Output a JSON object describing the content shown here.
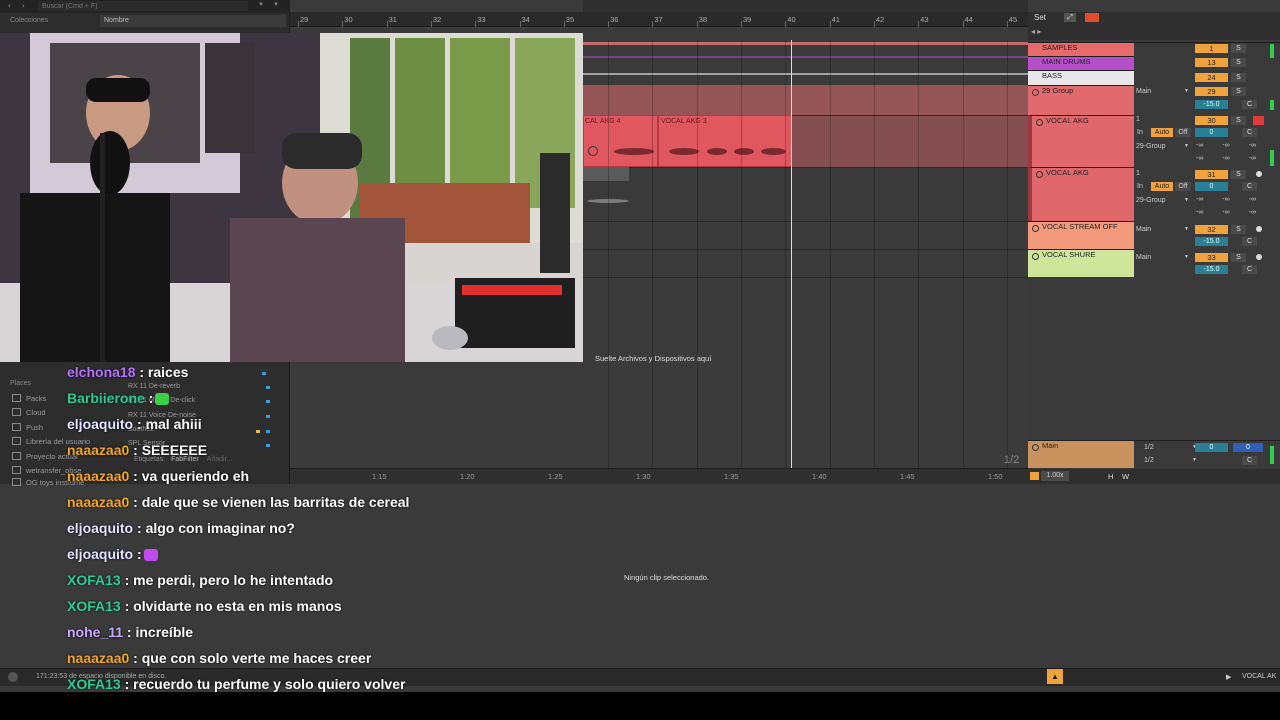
{
  "browser": {
    "search_placeholder": "Buscar (Cmd + F)",
    "collections_label": "Colecciones",
    "name_header": "Nombre",
    "places_label": "Places",
    "places": [
      "Packs",
      "Cloud",
      "Push",
      "Librería del usuario",
      "Proyecto actual",
      "wetransfer_obse",
      "OG toys instrume"
    ],
    "files": [
      "RX 11 De-reverb",
      "RX 11 Mouth De-click",
      "RX 11 Voice De-noise",
      "Soothe2",
      "SPL Sensor"
    ],
    "labels_text": "Etiquetas:",
    "labels_value": "FabFilter",
    "labels_add": "Añadir..."
  },
  "arrangement": {
    "bar_numbers": [
      "29",
      "30",
      "31",
      "32",
      "33",
      "34",
      "35",
      "36",
      "37",
      "38",
      "39",
      "40",
      "41",
      "42",
      "43",
      "44",
      "45"
    ],
    "drop_hint": "Suelte Archivos y Dispositivos aquí",
    "page_indicator": "1/2",
    "time_labels": [
      "1:15",
      "1:20",
      "1:25",
      "1:30",
      "1:35",
      "1:40",
      "1:45",
      "1:50"
    ],
    "clips": [
      {
        "label": "CAL AKG 4"
      },
      {
        "label": "VOCAL AKG 3"
      }
    ]
  },
  "top_right": {
    "set_label": "Set"
  },
  "tracks": [
    {
      "name": "SAMPLES",
      "number": "1",
      "solo": "S",
      "color": "#e86a6a"
    },
    {
      "name": "MAIN DRUMS",
      "number": "13",
      "solo": "S",
      "color": "#b64fc9"
    },
    {
      "name": "BASS",
      "number": "24",
      "solo": "S",
      "color": "#e7e7ea"
    },
    {
      "name": "29 Group",
      "number": "29",
      "solo": "S",
      "route": "Main",
      "volume": "-15.0",
      "color": "#e06a6d"
    },
    {
      "name": "VOCAL AKG",
      "number": "30",
      "solo": "S",
      "input": "1",
      "auto": "Auto",
      "off": "Off",
      "route": "29-Group",
      "volume": "0",
      "color": "#e0676c"
    },
    {
      "name": "VOCAL AKG",
      "number": "31",
      "solo": "S",
      "input": "1",
      "auto": "Auto",
      "off": "Off",
      "route": "29-Group",
      "volume": "0",
      "color": "#e0676c"
    },
    {
      "name": "VOCAL STREAM OFF",
      "number": "32",
      "solo": "S",
      "route": "Main",
      "volume": "-15.0",
      "color": "#f29a7b"
    },
    {
      "name": "VOCAL SHURE",
      "number": "33",
      "solo": "S",
      "route": "Main",
      "volume": "-15.0",
      "color": "#cfe59a"
    }
  ],
  "send_values": [
    "-∞",
    "-∞",
    "-∞"
  ],
  "in_label": "In",
  "center_label": "C",
  "main_track": {
    "name": "Main",
    "input_a": "1/2",
    "input_b": "1/2",
    "volume": "0",
    "pan_value": "0",
    "tempo": "1.00x",
    "h": "H",
    "w": "W"
  },
  "detail": {
    "no_clip": "Ningún clip seleccionado."
  },
  "status": {
    "disk_text": "171:23:53 de espacio disponible en disco.",
    "selected_track": "VOCAL AK"
  },
  "chat": [
    {
      "user": "elchona18",
      "color": "#b572ff",
      "message": ": raices"
    },
    {
      "user": "Barbiierone",
      "color": "#2ecc9a",
      "message": ":",
      "emote": true,
      "emote_color": "#3ecf4a"
    },
    {
      "user": "eljoaquito",
      "color": "#e3e3ff",
      "message": ": mal ahiii"
    },
    {
      "user": "naaazaa0",
      "color": "#f5a623",
      "message": ": SEEEEEE"
    },
    {
      "user": "naaazaa0",
      "color": "#f5a623",
      "message": ": va queriendo eh"
    },
    {
      "user": "naaazaa0",
      "color": "#f5a623",
      "message": ": dale que se vienen las barritas de cereal"
    },
    {
      "user": "eljoaquito",
      "color": "#e3e3ff",
      "message": ": algo con imaginar no?"
    },
    {
      "user": "eljoaquito",
      "color": "#e3e3ff",
      "message": ":",
      "emote": true,
      "emote_color": "#c04cf0"
    },
    {
      "user": "XOFA13",
      "color": "#2ecc9a",
      "message": ": me perdi, pero lo he intentado"
    },
    {
      "user": "XOFA13",
      "color": "#2ecc9a",
      "message": ": olvidarte no esta en mis manos"
    },
    {
      "user": "nohe_11",
      "color": "#c8a8ff",
      "message": ": increíble"
    },
    {
      "user": "naaazaa0",
      "color": "#f5a623",
      "message": ": que con solo verte me haces creer"
    },
    {
      "user": "XOFA13",
      "color": "#2ecc9a",
      "message": ": recuerdo tu perfume y solo quiero volver"
    }
  ]
}
